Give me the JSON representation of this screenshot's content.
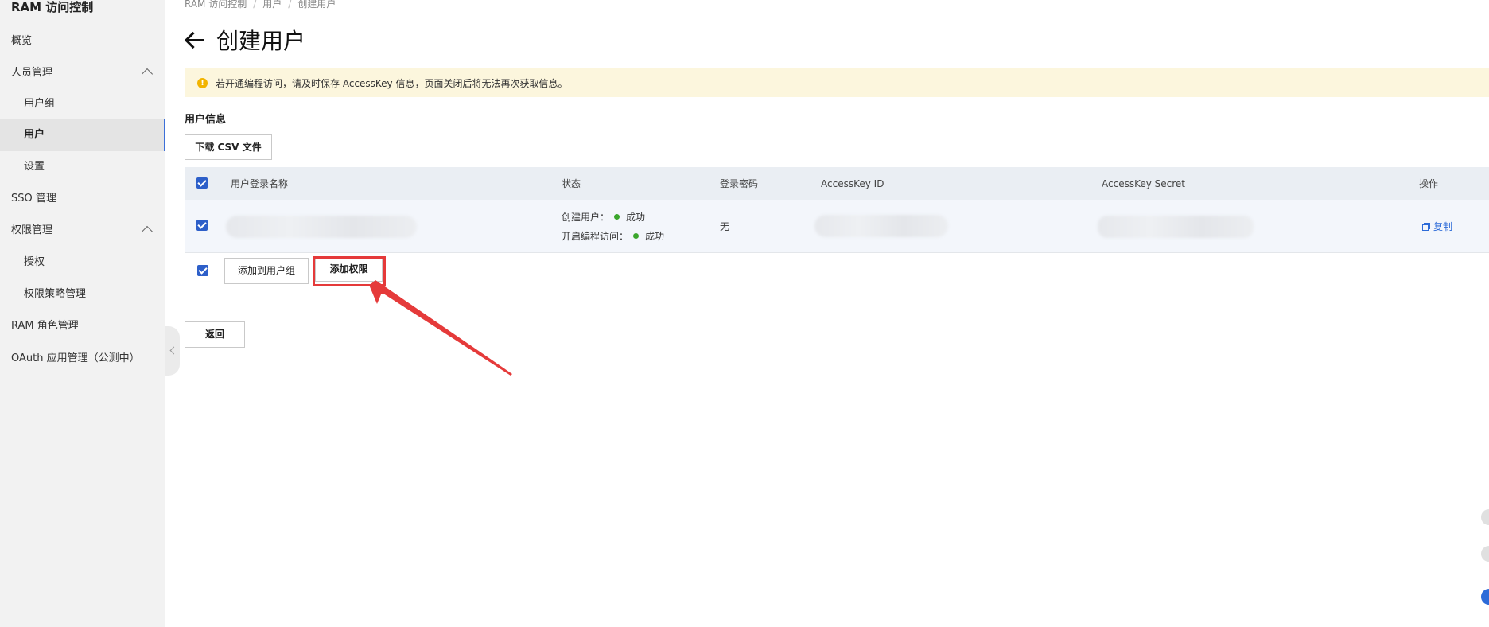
{
  "sidebar": {
    "title": "RAM 访问控制",
    "items": [
      {
        "label": "概览"
      },
      {
        "label": "人员管理"
      },
      {
        "label": "用户组"
      },
      {
        "label": "用户"
      },
      {
        "label": "设置"
      },
      {
        "label": "SSO 管理"
      },
      {
        "label": "权限管理"
      },
      {
        "label": "授权"
      },
      {
        "label": "权限策略管理"
      },
      {
        "label": "RAM 角色管理"
      },
      {
        "label": "OAuth 应用管理（公测中）"
      }
    ]
  },
  "breadcrumb": {
    "items": [
      "RAM 访问控制",
      "用户",
      "创建用户"
    ],
    "separator": "/"
  },
  "page": {
    "title": "创建用户"
  },
  "alert": {
    "icon": "warning-icon",
    "text": "若开通编程访问，请及时保存 AccessKey 信息，页面关闭后将无法再次获取信息。",
    "icon_symbol": "!"
  },
  "section": {
    "title": "用户信息"
  },
  "toolbar": {
    "download_csv_label": "下载 CSV 文件"
  },
  "table": {
    "columns": [
      "用户登录名称",
      "状态",
      "登录密码",
      "AccessKey ID",
      "AccessKey Secret",
      "操作"
    ],
    "rows": [
      {
        "login_name": "",
        "status": [
          {
            "label": "创建用户：",
            "value": "成功"
          },
          {
            "label": "开启编程访问：",
            "value": "成功"
          }
        ],
        "password": "无",
        "accesskey_id": "",
        "accesskey_secret": "",
        "action_label": "复制"
      }
    ]
  },
  "bulk_actions": {
    "add_to_group_label": "添加到用户组",
    "add_permission_label": "添加权限"
  },
  "footer": {
    "back_label": "返回"
  },
  "colors": {
    "accent": "#2d5fc9",
    "alert_bg": "#fcf6dd",
    "success": "#3aa62c",
    "annotation": "#e53a3a"
  }
}
